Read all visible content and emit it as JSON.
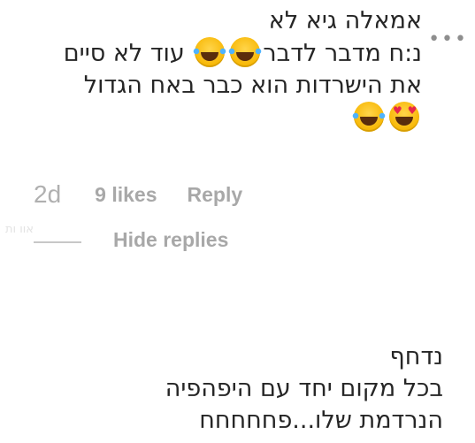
{
  "comment": {
    "line1": "אמאלה גיא לא",
    "line2_before": "נ:ח מדבר לדבר",
    "line2_after": "עוד לא סיים",
    "line3": "את הישרדות הוא כבר באח הגדול",
    "emojis": [
      "face-with-tears-of-joy",
      "face-with-tears-of-joy",
      "smiling-face-with-heart-eyes",
      "face-with-tears-of-joy"
    ],
    "more_icon": "•••",
    "age": "2d",
    "likes": "9 likes",
    "reply": "Reply"
  },
  "replies_toggle": {
    "label": "Hide replies",
    "ghost_text": "אוו ות"
  },
  "reply": {
    "line1": "נדחף",
    "line2": "בכל מקום יחד עם היפהפיה",
    "line3": "הנרדמת שלו...פחחחחח"
  },
  "colors": {
    "text": "#262626",
    "meta": "#a8a8a8",
    "background": "#ffffff"
  }
}
